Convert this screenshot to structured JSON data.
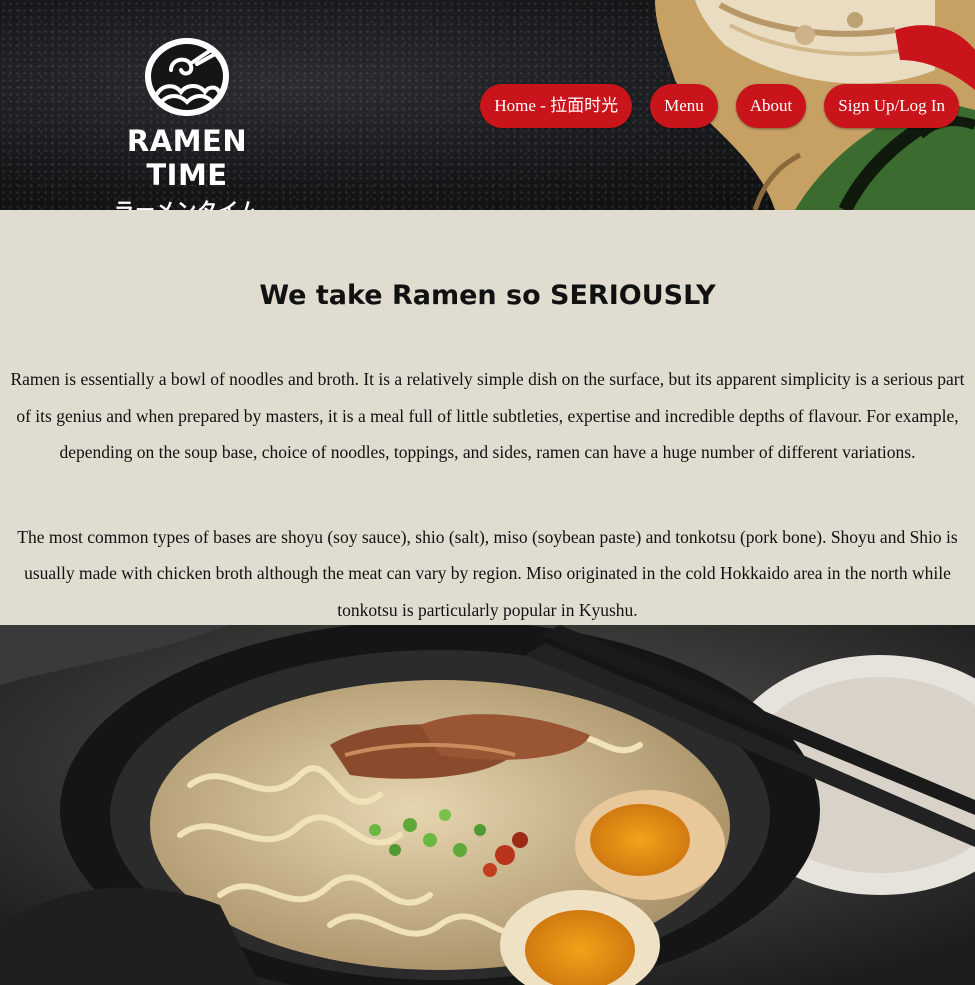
{
  "logo": {
    "name": "RAMEN TIME",
    "subtitle": "ラーメンタイム"
  },
  "nav": {
    "items": [
      {
        "label": "Home - 拉面时光"
      },
      {
        "label": "Menu"
      },
      {
        "label": "About"
      },
      {
        "label": "Sign Up/Log In"
      }
    ]
  },
  "main": {
    "heading": "We take Ramen so SERIOUSLY",
    "paragraph_1": "Ramen is essentially a bowl of noodles and broth. It is a relatively simple dish on the surface, but its apparent simplicity is a serious part of its genius and when prepared by masters, it is a meal full of little subtleties, expertise and incredible depths of flavour. For example, depending on the soup base, choice of noodles, toppings, and sides, ramen can have a huge number of different variations.",
    "paragraph_2": "The most common types of bases are shoyu (soy sauce), shio (salt), miso (soybean paste) and tonkotsu (pork bone). Shoyu and Shio is usually made with chicken broth although the meat can vary by region. Miso originated in the cold Hokkaido area in the north while tonkotsu is particularly popular in Kyushu."
  },
  "colors": {
    "nav_button": "#c8141a",
    "content_background": "#e0dcd0",
    "header_background": "#141517"
  }
}
